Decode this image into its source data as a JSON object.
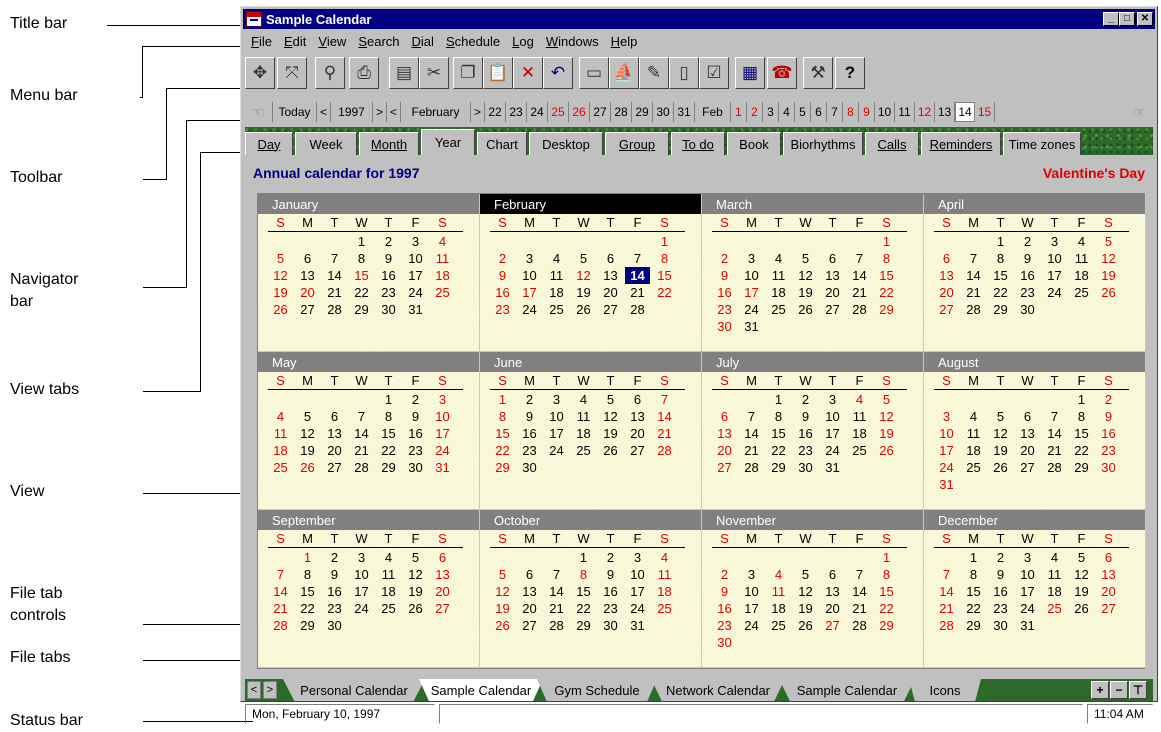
{
  "callouts": {
    "title_bar": "Title bar",
    "menu_bar": "Menu bar",
    "toolbar": "Toolbar",
    "navigator_line1": "Navigator",
    "navigator_line2": "bar",
    "view_tabs": "View tabs",
    "view": "View",
    "file_tab_controls_line1": "File tab",
    "file_tab_controls_line2": "controls",
    "file_tabs": "File tabs",
    "status_bar": "Status bar"
  },
  "window": {
    "title": "Sample Calendar",
    "buttons": {
      "minimize": "_",
      "maximize": "□",
      "close": "✕"
    }
  },
  "menu": [
    {
      "u": "F",
      "rest": "ile"
    },
    {
      "u": "E",
      "rest": "dit"
    },
    {
      "u": "V",
      "rest": "iew"
    },
    {
      "u": "S",
      "rest": "earch"
    },
    {
      "u": "D",
      "rest": "ial"
    },
    {
      "u": "S",
      "rest": "chedule"
    },
    {
      "u": "L",
      "rest": "og"
    },
    {
      "u": "W",
      "rest": "indows"
    },
    {
      "u": "H",
      "rest": "elp"
    }
  ],
  "toolbar": {
    "icons": [
      "move-icon",
      "resize-icon",
      "find-icon",
      "print-icon",
      "print-preview-icon",
      "cut-icon",
      "copy-icon",
      "paste-icon",
      "delete-icon",
      "undo-icon",
      "scheduler-icon",
      "sailboat-icon",
      "notes-icon",
      "journal-icon",
      "todo-icon",
      "address-book-icon",
      "phone-icon",
      "tools-icon",
      "help-icon"
    ],
    "help_label": "?"
  },
  "navigator": {
    "today": "Today",
    "year": "1997",
    "month": "February",
    "month_short": "Feb",
    "prev_arrow": "<",
    "next_arrow": ">",
    "prev_days": [
      {
        "d": "22",
        "red": false
      },
      {
        "d": "23",
        "red": false
      },
      {
        "d": "24",
        "red": false
      },
      {
        "d": "25",
        "red": true
      },
      {
        "d": "26",
        "red": true
      },
      {
        "d": "27",
        "red": false
      },
      {
        "d": "28",
        "red": false
      },
      {
        "d": "29",
        "red": false
      },
      {
        "d": "30",
        "red": false
      },
      {
        "d": "31",
        "red": false
      }
    ],
    "feb_days": [
      {
        "d": "1",
        "red": true
      },
      {
        "d": "2",
        "red": true
      },
      {
        "d": "3",
        "red": false
      },
      {
        "d": "4",
        "red": false
      },
      {
        "d": "5",
        "red": false
      },
      {
        "d": "6",
        "red": false
      },
      {
        "d": "7",
        "red": false
      },
      {
        "d": "8",
        "red": true
      },
      {
        "d": "9",
        "red": true
      },
      {
        "d": "10",
        "red": false
      },
      {
        "d": "11",
        "red": false
      },
      {
        "d": "12",
        "red": true
      },
      {
        "d": "13",
        "red": false
      },
      {
        "d": "14",
        "red": false,
        "today": true
      },
      {
        "d": "15",
        "red": true
      }
    ]
  },
  "view_tabs": [
    {
      "label": "Day",
      "u": true
    },
    {
      "label": "Week",
      "u": false
    },
    {
      "label": "Month",
      "u": true
    },
    {
      "label": "Year",
      "u": false,
      "active": true
    },
    {
      "label": "Chart",
      "u": false
    },
    {
      "label": "Desktop",
      "u": false
    },
    {
      "label": "Group",
      "u": true
    },
    {
      "label": "To do",
      "u": true
    },
    {
      "label": "Book",
      "u": false
    },
    {
      "label": "Biorhythms",
      "u": false
    },
    {
      "label": "Calls",
      "u": true
    },
    {
      "label": "Reminders",
      "u": true
    },
    {
      "label": "Time zones",
      "u": false
    }
  ],
  "view": {
    "title": "Annual calendar for 1997",
    "holiday": "Valentine's Day",
    "dow": [
      "S",
      "M",
      "T",
      "W",
      "T",
      "F",
      "S"
    ],
    "months": [
      {
        "name": "January",
        "start": 3,
        "days": 31,
        "hol": [
          15,
          20
        ]
      },
      {
        "name": "February",
        "start": 6,
        "days": 28,
        "hol": [
          12,
          17
        ],
        "current": true,
        "today": 14
      },
      {
        "name": "March",
        "start": 6,
        "days": 31,
        "hol": [
          17
        ]
      },
      {
        "name": "April",
        "start": 2,
        "days": 30,
        "hol": []
      },
      {
        "name": "May",
        "start": 4,
        "days": 31,
        "hol": [
          26
        ]
      },
      {
        "name": "June",
        "start": 0,
        "days": 30,
        "hol": []
      },
      {
        "name": "July",
        "start": 2,
        "days": 31,
        "hol": [
          4
        ]
      },
      {
        "name": "August",
        "start": 5,
        "days": 31,
        "hol": []
      },
      {
        "name": "September",
        "start": 1,
        "days": 30,
        "hol": [
          1
        ]
      },
      {
        "name": "October",
        "start": 3,
        "days": 31,
        "hol": [
          8
        ]
      },
      {
        "name": "November",
        "start": 6,
        "days": 30,
        "hol": [
          4,
          11,
          27
        ]
      },
      {
        "name": "December",
        "start": 1,
        "days": 31,
        "hol": [
          25
        ]
      }
    ]
  },
  "file_tabs": {
    "prev": "<",
    "next": ">",
    "tabs": [
      {
        "label": "Personal Calendar"
      },
      {
        "label": "Sample Calendar",
        "active": true
      },
      {
        "label": "Gym Schedule"
      },
      {
        "label": "Network Calendar"
      },
      {
        "label": "Sample Calendar"
      },
      {
        "label": "Icons"
      }
    ],
    "controls": [
      "+",
      "−",
      "⊤"
    ]
  },
  "status": {
    "date": "Mon, February 10, 1997",
    "time": "11:04 AM"
  }
}
